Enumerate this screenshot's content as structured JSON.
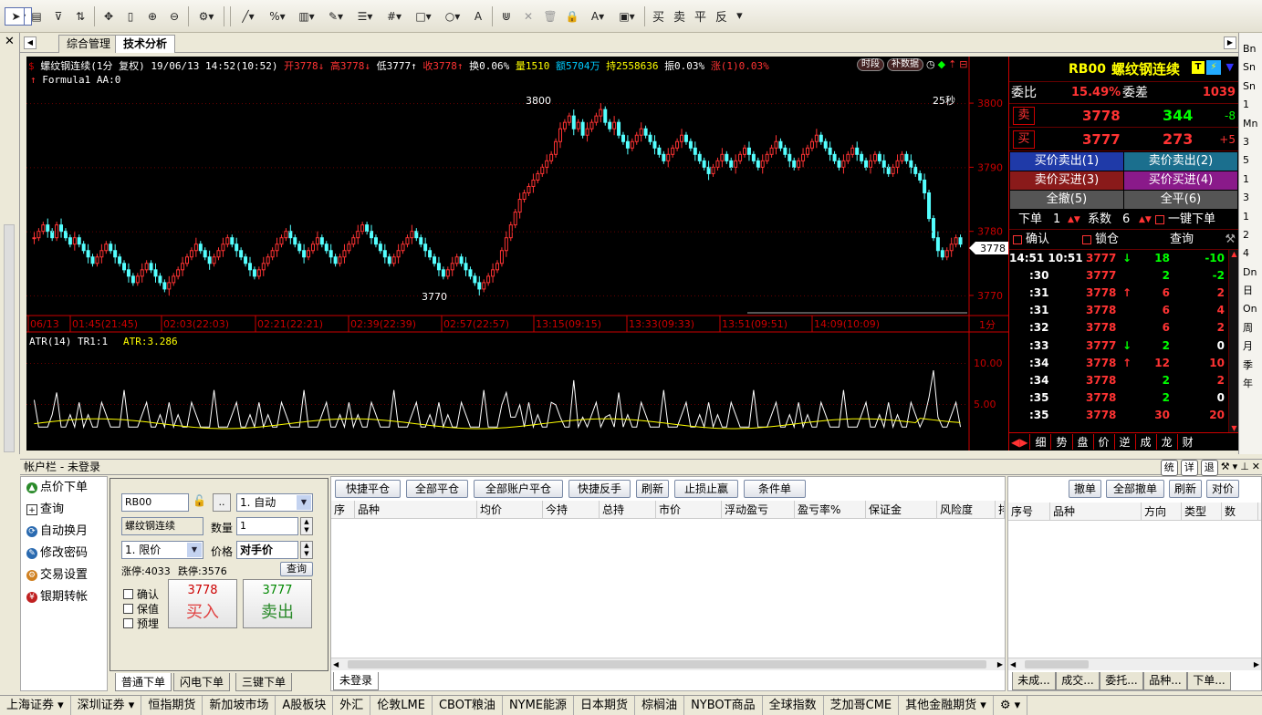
{
  "toolbar": {
    "text_buttons": [
      "买",
      "卖",
      "平",
      "反"
    ],
    "icons": [
      "play-icon",
      "document-icon",
      "dollar-icon",
      "filter-icon",
      "swap-icon",
      "move-icon",
      "ruler-icon",
      "zoom-in-icon",
      "zoom-out-icon",
      "gear-icon",
      "cursor-icon",
      "line-icon",
      "percent-icon",
      "bars-icon",
      "pen-icon",
      "list-icon",
      "grid-icon",
      "rect-icon",
      "circle-icon",
      "text-icon",
      "magnet-icon",
      "close-icon",
      "trash-icon",
      "lock-icon",
      "color-icon",
      "save-icon"
    ]
  },
  "tabs": [
    {
      "label": "综合管理"
    },
    {
      "label": "技术分析"
    }
  ],
  "chart_header": {
    "symbol": "螺纹钢连续(1分  复权)",
    "datetime": "19/06/13 14:52(10:52)",
    "open": "开3778",
    "high": "高3778",
    "low": "低3777",
    "close": "收3778",
    "turnover": "换0.06%",
    "volume": "量1510",
    "amount": "额5704万",
    "oi": "持2558636",
    "amp": "振0.03%",
    "change": "涨(1)0.03%",
    "btn_period": "时段",
    "btn_fill": "补数据",
    "formula": "Formula1 AA:0",
    "countdown": "25秒",
    "high_mark": "3800",
    "low_mark": "3770",
    "cur_price": "3778",
    "period_label": "1分",
    "atr": "ATR(14)  TR1:1",
    "atr_value": "ATR:3.286"
  },
  "chart_data": {
    "type": "candlestick",
    "ylim": [
      3768,
      3803
    ],
    "yticks": [
      3800,
      3790,
      3780,
      3770
    ],
    "xticks": [
      "06/13",
      "01:45(21:45)",
      "02:03(22:03)",
      "02:21(22:21)",
      "02:39(22:39)",
      "02:57(22:57)",
      "13:15(09:15)",
      "13:33(09:33)",
      "13:51(09:51)",
      "14:09(10:09)"
    ],
    "ohlc_close": [
      3779,
      3780,
      3781,
      3780,
      3779,
      3781,
      3780,
      3779,
      3778,
      3779,
      3778,
      3777,
      3776,
      3775,
      3776,
      3777,
      3778,
      3777,
      3776,
      3775,
      3774,
      3773,
      3772,
      3773,
      3774,
      3775,
      3774,
      3773,
      3772,
      3771,
      3772,
      3773,
      3774,
      3775,
      3776,
      3777,
      3778,
      3777,
      3776,
      3775,
      3776,
      3777,
      3778,
      3779,
      3778,
      3777,
      3776,
      3775,
      3774,
      3773,
      3774,
      3775,
      3776,
      3777,
      3778,
      3779,
      3780,
      3779,
      3778,
      3777,
      3776,
      3777,
      3778,
      3779,
      3778,
      3777,
      3776,
      3775,
      3776,
      3777,
      3778,
      3779,
      3780,
      3781,
      3780,
      3779,
      3778,
      3777,
      3776,
      3775,
      3776,
      3777,
      3778,
      3779,
      3780,
      3779,
      3778,
      3777,
      3776,
      3775,
      3774,
      3773,
      3774,
      3775,
      3776,
      3775,
      3774,
      3773,
      3772,
      3771,
      3772,
      3773,
      3774,
      3775,
      3777,
      3779,
      3781,
      3783,
      3785,
      3786,
      3787,
      3788,
      3789,
      3790,
      3791,
      3792,
      3794,
      3796,
      3797,
      3798,
      3796,
      3797,
      3795,
      3796,
      3797,
      3798,
      3799,
      3797,
      3796,
      3797,
      3795,
      3794,
      3793,
      3794,
      3795,
      3796,
      3795,
      3794,
      3793,
      3792,
      3791,
      3792,
      3793,
      3794,
      3795,
      3794,
      3793,
      3792,
      3791,
      3790,
      3789,
      3790,
      3791,
      3792,
      3791,
      3790,
      3791,
      3792,
      3793,
      3792,
      3791,
      3790,
      3791,
      3792,
      3793,
      3794,
      3793,
      3792,
      3791,
      3790,
      3791,
      3792,
      3793,
      3794,
      3795,
      3794,
      3793,
      3792,
      3791,
      3790,
      3791,
      3792,
      3793,
      3792,
      3791,
      3790,
      3791,
      3792,
      3791,
      3790,
      3789,
      3790,
      3791,
      3792,
      3791,
      3790,
      3789,
      3788,
      3786,
      3782,
      3779,
      3777,
      3776,
      3777,
      3778,
      3779,
      3778
    ],
    "atr_ticks": [
      "10.00",
      "5.00"
    ],
    "atr_ylim": [
      0,
      12
    ]
  },
  "quote": {
    "code": "RB00",
    "name": "螺纹钢连续",
    "wei_bi_label": "委比",
    "wei_bi": "15.49%",
    "wei_cha_label": "委差",
    "wei_cha": "1039",
    "sell_label": "卖",
    "sell_price": "3778",
    "sell_vol": "344",
    "sell_chg": "-8",
    "buy_label": "买",
    "buy_price": "3777",
    "buy_vol": "273",
    "buy_chg": "+5",
    "btn1": "买价卖出(1)",
    "btn2": "卖价卖出(2)",
    "btn3": "卖价买进(3)",
    "btn4": "买价买进(4)",
    "btn5": "全撤(5)",
    "btn6": "全平(6)",
    "order_label": "下单",
    "order_qty": "1",
    "coef_label": "系数",
    "coef": "6",
    "one_click": "一键下单",
    "confirm": "确认",
    "lock": "锁仓",
    "query": "查询",
    "ticks": [
      {
        "t": "14:51",
        "t2": "10:51",
        "p": "3777",
        "v": "18",
        "c": "-10",
        "arrow": "down"
      },
      {
        "t": ":30",
        "t2": "",
        "p": "3777",
        "v": "2",
        "c": "-2",
        "arrow": ""
      },
      {
        "t": ":31",
        "t2": "",
        "p": "3778",
        "v": "6",
        "c": "2",
        "arrow": "up"
      },
      {
        "t": ":31",
        "t2": "",
        "p": "3778",
        "v": "6",
        "c": "4",
        "arrow": ""
      },
      {
        "t": ":32",
        "t2": "",
        "p": "3778",
        "v": "6",
        "c": "2",
        "arrow": ""
      },
      {
        "t": ":33",
        "t2": "",
        "p": "3777",
        "v": "2",
        "c": "0",
        "arrow": "down"
      },
      {
        "t": ":34",
        "t2": "",
        "p": "3778",
        "v": "12",
        "c": "10",
        "arrow": "up"
      },
      {
        "t": ":34",
        "t2": "",
        "p": "3778",
        "v": "2",
        "c": "2",
        "arrow": ""
      },
      {
        "t": ":35",
        "t2": "",
        "p": "3778",
        "v": "2",
        "c": "0",
        "arrow": ""
      },
      {
        "t": ":35",
        "t2": "",
        "p": "3778",
        "v": "30",
        "c": "20",
        "arrow": ""
      }
    ],
    "bottom_tabs": [
      "细",
      "势",
      "盘",
      "价",
      "逆",
      "成",
      "龙",
      "财"
    ]
  },
  "account": {
    "title": "帐户栏 - 未登录",
    "right_buttons": [
      "统",
      "详",
      "退"
    ],
    "menu": [
      {
        "label": "点价下单"
      },
      {
        "label": "查询"
      },
      {
        "label": "自动换月"
      },
      {
        "label": "修改密码"
      },
      {
        "label": "交易设置"
      },
      {
        "label": "银期转帐"
      }
    ],
    "form": {
      "code": "RB00",
      "ellipsis": "..",
      "mode": "1. 自动",
      "name": "螺纹钢连续",
      "qty_label": "数量",
      "qty": "1",
      "price_type": "1. 限价",
      "price_label": "价格",
      "price": "对手价",
      "limit_up": "涨停:4033",
      "limit_down": "跌停:3576",
      "query_btn": "查询",
      "cb_confirm": "确认",
      "cb_keep": "保值",
      "cb_preorder": "预埋",
      "buy_price": "3778",
      "buy_label": "买入",
      "sell_price": "3777",
      "sell_label": "卖出"
    },
    "subtabs": [
      "普通下单",
      "闪电下单",
      "三键下单"
    ],
    "pos_buttons": [
      "快捷平仓",
      "全部平仓",
      "全部账户平仓",
      "快捷反手",
      "刷新",
      "止损止赢",
      "条件单"
    ],
    "pos_headers": [
      "序",
      "品种",
      "均价",
      "今持",
      "总持",
      "市价",
      "浮动盈亏",
      "盈亏率%",
      "保证金",
      "风险度",
      "排"
    ],
    "pos_tab": "未登录",
    "order_buttons": [
      "撤单",
      "全部撤单",
      "刷新",
      "对价"
    ],
    "order_headers": [
      "序号",
      "品种",
      "方向",
      "类型",
      "数"
    ],
    "order_tabs": [
      "未成...",
      "成交...",
      "委托...",
      "品种...",
      "下单..."
    ]
  },
  "right_strip": [
    "Bn",
    "Sn",
    "Sn",
    "1",
    "Mn",
    "3",
    "5",
    "1",
    "3",
    "1",
    "2",
    "4",
    "Dn",
    "日",
    "On",
    "周",
    "月",
    "季",
    "年"
  ],
  "bottom_tabs": [
    "上海证券",
    "深圳证券",
    "恒指期货",
    "新加坡市场",
    "A股板块",
    "外汇",
    "伦敦LME",
    "CBOT粮油",
    "NYME能源",
    "日本期货",
    "棕榈油",
    "NYBOT商品",
    "全球指数",
    "芝加哥CME",
    "其他金融期货"
  ]
}
